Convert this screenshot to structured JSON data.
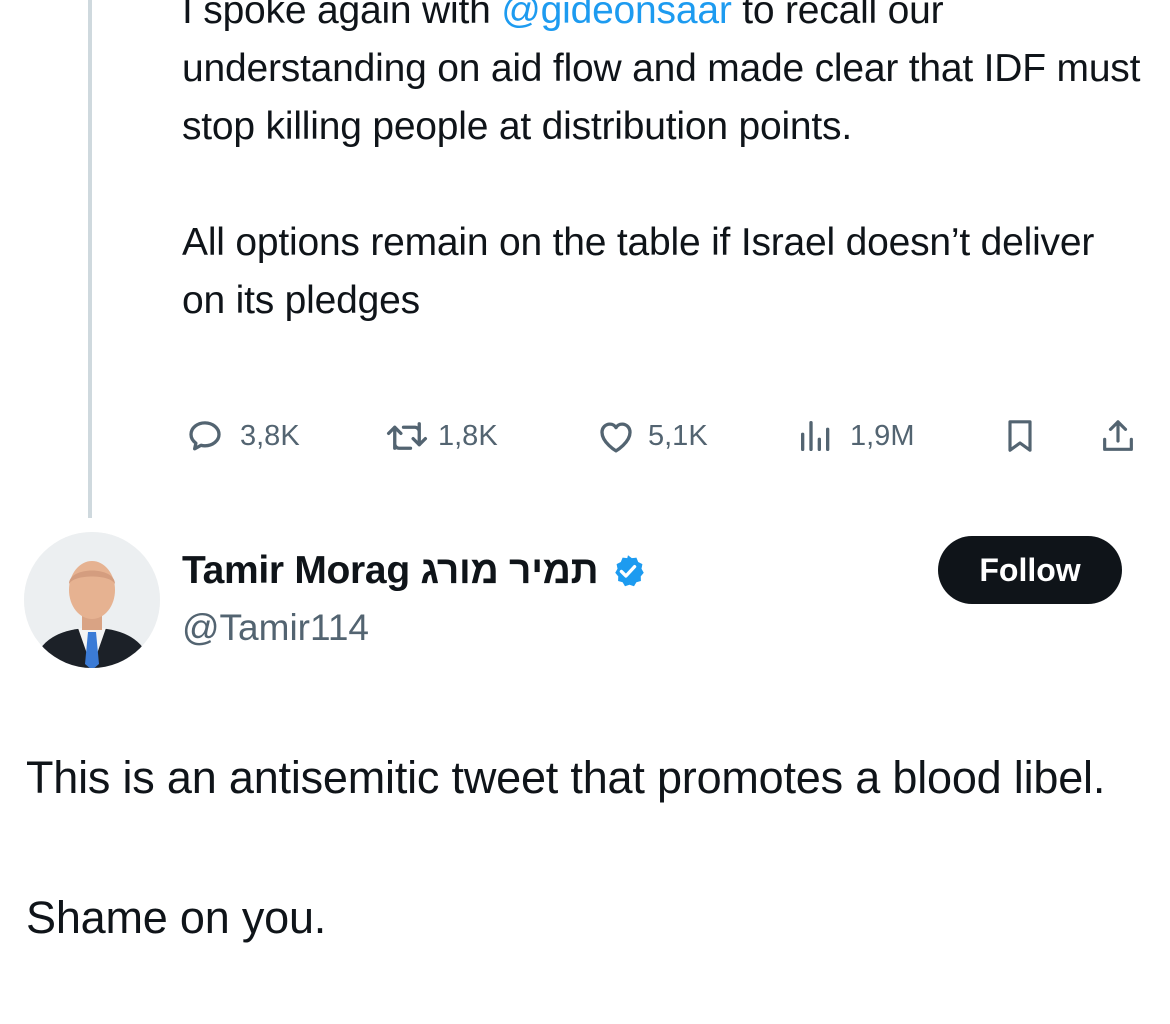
{
  "quoted_tweet": {
    "paragraph_1": {
      "before_mention": "I spoke again with ",
      "mention": "@gideonsaar",
      "after_mention": " to recall our understanding on aid flow and made clear that IDF must stop killing people at distribution points."
    },
    "paragraph_2": "All options remain on the table if Israel doesn’t deliver on its pledges",
    "stats": {
      "replies": "3,8K",
      "reposts": "1,8K",
      "likes": "5,1K",
      "views": "1,9M"
    },
    "icons": [
      "reply-icon",
      "repost-icon",
      "like-icon",
      "views-icon",
      "bookmark-icon",
      "share-icon"
    ]
  },
  "reply": {
    "author": {
      "display_name": "Tamir Morag תמיר מורג",
      "handle": "@Tamir114",
      "verified": true
    },
    "follow_label": "Follow",
    "paragraph_1": "This is an antisemitic tweet that promotes a blood libel.",
    "paragraph_2": "Shame on you."
  },
  "colors": {
    "text": "#0f1419",
    "secondary": "#536471",
    "link": "#1d9bf0",
    "verified_badge": "#1d9bf0",
    "follow_button": "#0f1419",
    "thread_line": "#cfd9de"
  }
}
